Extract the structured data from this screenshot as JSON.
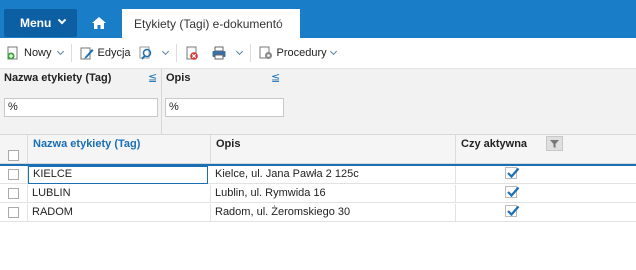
{
  "topbar": {
    "menu_label": "Menu",
    "active_tab": "Etykiety (Tagi) e-dokumentó"
  },
  "toolbar": {
    "new_label": "Nowy",
    "edit_label": "Edycja",
    "procedures_label": "Procedury"
  },
  "filters": {
    "name_label": "Nazwa etykiety (Tag)",
    "name_operator": "≦",
    "name_value": "%",
    "desc_label": "Opis",
    "desc_operator": "≦",
    "desc_value": "%"
  },
  "grid": {
    "headers": {
      "name": "Nazwa etykiety (Tag)",
      "description": "Opis",
      "active": "Czy aktywna"
    },
    "rows": [
      {
        "name": "KIELCE",
        "description": "Kielce, ul. Jana Pawła 2 125c",
        "active": true
      },
      {
        "name": "LUBLIN",
        "description": "Lublin, ul. Rymwida 16",
        "active": true
      },
      {
        "name": "RADOM",
        "description": "Radom, ul. Żeromskiego 30",
        "active": true
      }
    ]
  },
  "colors": {
    "topbar": "#1a7dc8",
    "menu_button": "#0d5fa3",
    "accent": "#1a6fb5"
  }
}
